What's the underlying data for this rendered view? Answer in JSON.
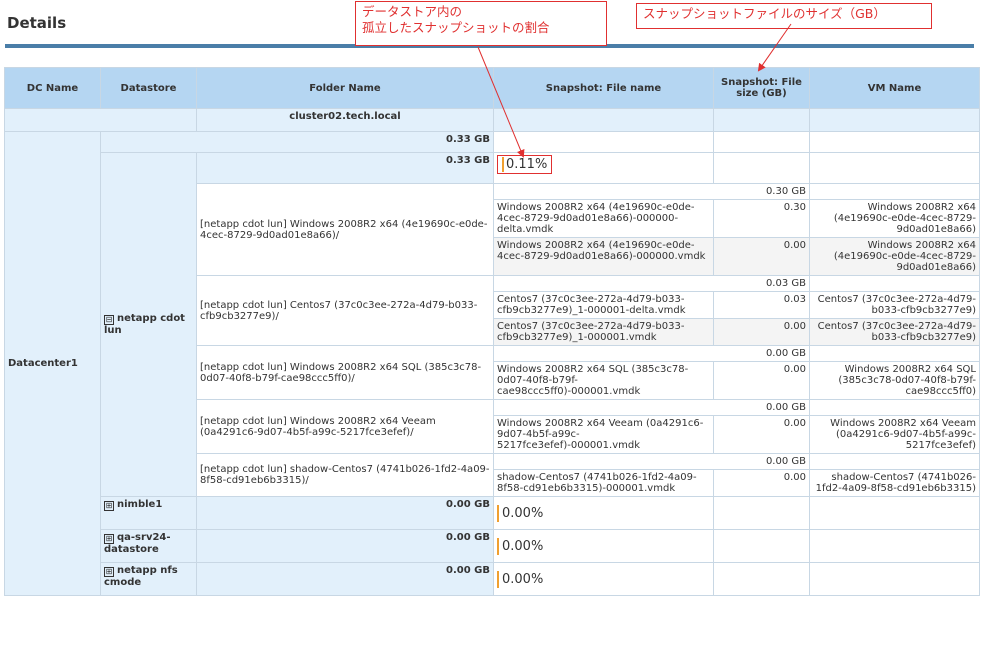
{
  "page": {
    "title": "Details"
  },
  "annotations": {
    "orphan_ratio": "データストア内の\n孤立したスナップショットの割合",
    "file_size": "スナップショットファイルのサイズ（GB）"
  },
  "table": {
    "headers": [
      "DC Name",
      "Datastore",
      "Folder Name",
      "Snapshot: File name",
      "Snapshot: File size (GB)",
      "VM Name"
    ],
    "cluster": "cluster02.tech.local",
    "cluster_total": "0.33  GB",
    "datacenter": "Datacenter1",
    "datastore_expanded": {
      "name": "netapp cdot lun",
      "expander": "⊟",
      "total": "0.33  GB",
      "percent": "0.11%",
      "folders": [
        {
          "name": "[netapp cdot lun] Windows 2008R2 x64 (4e19690c-e0de-4cec-8729-9d0ad01e8a66)/",
          "subtotal": "0.30  GB",
          "files": [
            {
              "file": "Windows 2008R2 x64 (4e19690c-e0de-4cec-8729-9d0ad01e8a66)-000000-delta.vmdk",
              "size": "0.30",
              "vm": "Windows 2008R2 x64 (4e19690c-e0de-4cec-8729-9d0ad01e8a66)"
            },
            {
              "file": "Windows 2008R2 x64 (4e19690c-e0de-4cec-8729-9d0ad01e8a66)-000000.vmdk",
              "size": "0.00",
              "vm": "Windows 2008R2 x64 (4e19690c-e0de-4cec-8729-9d0ad01e8a66)"
            }
          ]
        },
        {
          "name": "[netapp cdot lun] Centos7 (37c0c3ee-272a-4d79-b033-cfb9cb3277e9)/",
          "subtotal": "0.03  GB",
          "files": [
            {
              "file": "Centos7 (37c0c3ee-272a-4d79-b033-cfb9cb3277e9)_1-000001-delta.vmdk",
              "size": "0.03",
              "vm": "Centos7 (37c0c3ee-272a-4d79-b033-cfb9cb3277e9)"
            },
            {
              "file": "Centos7 (37c0c3ee-272a-4d79-b033-cfb9cb3277e9)_1-000001.vmdk",
              "size": "0.00",
              "vm": "Centos7 (37c0c3ee-272a-4d79-b033-cfb9cb3277e9)"
            }
          ]
        },
        {
          "name": "[netapp cdot lun] Windows 2008R2 x64 SQL (385c3c78-0d07-40f8-b79f-cae98ccc5ff0)/",
          "subtotal": "0.00  GB",
          "files": [
            {
              "file": "Windows 2008R2 x64 SQL (385c3c78-0d07-40f8-b79f-cae98ccc5ff0)-000001.vmdk",
              "size": "0.00",
              "vm": "Windows 2008R2 x64 SQL (385c3c78-0d07-40f8-b79f-cae98ccc5ff0)"
            }
          ]
        },
        {
          "name": "[netapp cdot lun] Windows 2008R2 x64 Veeam (0a4291c6-9d07-4b5f-a99c-5217fce3efef)/",
          "subtotal": "0.00  GB",
          "files": [
            {
              "file": "Windows 2008R2 x64 Veeam (0a4291c6-9d07-4b5f-a99c-5217fce3efef)-000001.vmdk",
              "size": "0.00",
              "vm": "Windows 2008R2 x64 Veeam (0a4291c6-9d07-4b5f-a99c-5217fce3efef)"
            }
          ]
        },
        {
          "name": "[netapp cdot lun] shadow-Centos7 (4741b026-1fd2-4a09-8f58-cd91eb6b3315)/",
          "subtotal": "0.00  GB",
          "files": [
            {
              "file": "shadow-Centos7 (4741b026-1fd2-4a09-8f58-cd91eb6b3315)-000001.vmdk",
              "size": "0.00",
              "vm": "shadow-Centos7 (4741b026-1fd2-4a09-8f58-cd91eb6b3315)"
            }
          ]
        }
      ]
    },
    "datastores_collapsed": [
      {
        "expander": "⊞",
        "name": "nimble1",
        "total": "0.00  GB",
        "percent": "0.00%"
      },
      {
        "expander": "⊞",
        "name": "qa-srv24-datastore",
        "total": "0.00  GB",
        "percent": "0.00%"
      },
      {
        "expander": "⊞",
        "name": "netapp nfs cmode",
        "total": "0.00  GB",
        "percent": "0.00%"
      }
    ]
  }
}
